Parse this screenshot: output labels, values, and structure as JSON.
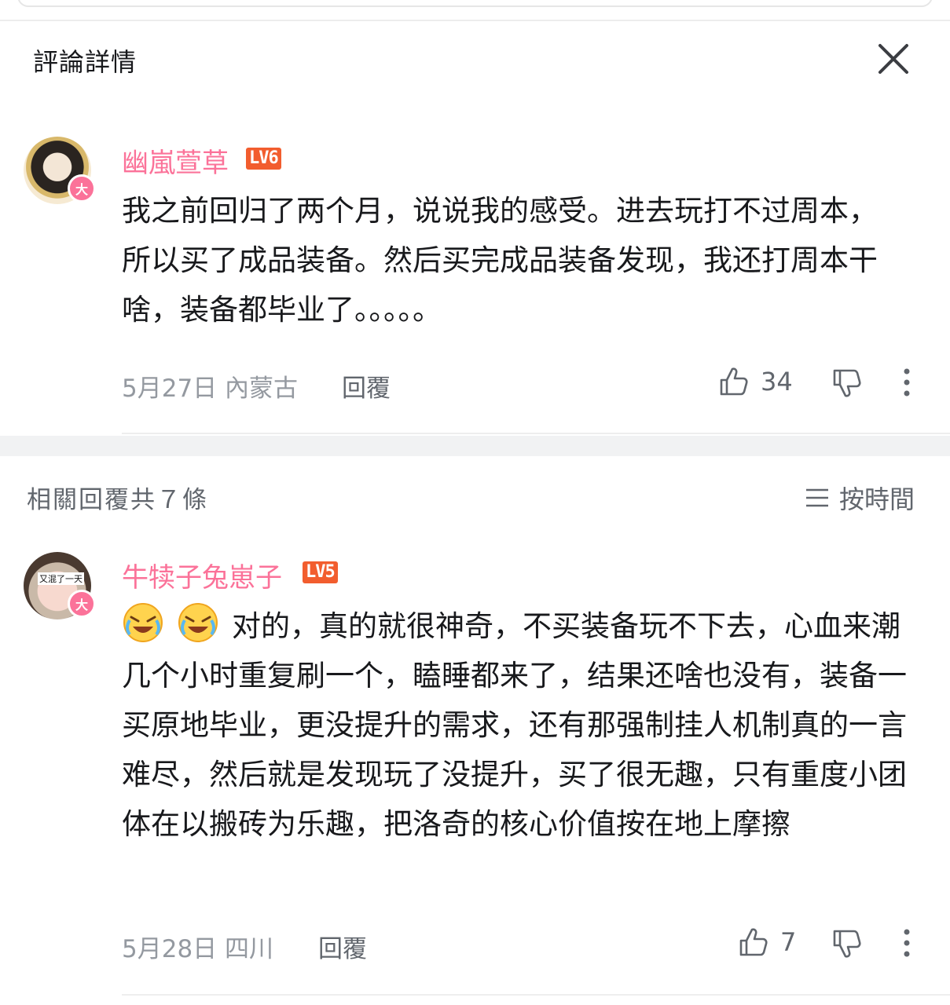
{
  "header": {
    "title": "評論詳情"
  },
  "main_comment": {
    "username": "幽嵐萱草",
    "level": "LV6",
    "vip_badge": "大",
    "text": "我之前回归了两个月，说说我的感受。进去玩打不过周本，所以买了成品装备。然后买完成品装备发现，我还打周本干啥，装备都毕业了。。。。。",
    "date_location": "5月27日 內蒙古",
    "reply_label": "回覆",
    "likes": "34"
  },
  "replies_section": {
    "title": "相關回覆共７條",
    "sort_label": "按時間"
  },
  "reply": {
    "username": "牛犊子兔崽子",
    "level": "LV5",
    "vip_badge": "大",
    "avatar_caption": "又混了一天",
    "text": "对的，真的就很神奇，不买装备玩不下去，心血来潮几个小时重复刷一个，瞌睡都来了，结果还啥也没有，装备一买原地毕业，更没提升的需求，还有那强制挂人机制真的一言难尽，然后就是发现玩了没提升，买了很无趣，只有重度小团体在以搬砖为乐趣，把洛奇的核心价值按在地上摩擦",
    "date_location": "5月28日 四川",
    "reply_label": "回覆",
    "likes": "7"
  },
  "colors": {
    "accent_pink": "#fb7299",
    "level_orange": "#f25d2e",
    "muted_text": "#9499a0"
  },
  "icons": [
    "close-icon",
    "thumbs-up-icon",
    "thumbs-down-icon",
    "more-vertical-icon",
    "sort-lines-icon",
    "crying-laugh-emoji"
  ]
}
